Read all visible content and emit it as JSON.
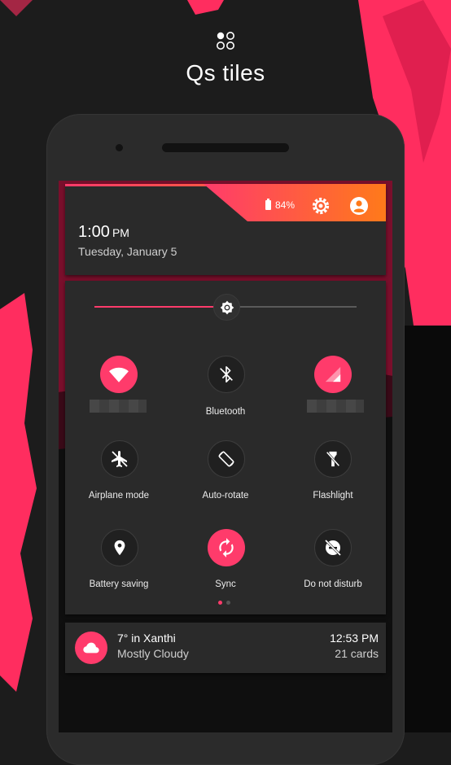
{
  "page": {
    "title": "Qs tiles",
    "title_icon": "four-dots-icon"
  },
  "colors": {
    "accent": "#ff3b6b",
    "gradient_start": "#ff3b6b",
    "gradient_end": "#ff7a1a",
    "panel": "#2a2a2a",
    "background": "#1c1c1c"
  },
  "status_header": {
    "battery_percent": "84%",
    "battery_icon": "battery-icon",
    "settings_icon": "gear-icon",
    "user_icon": "account-circle-icon",
    "time": "1:00",
    "ampm": "PM",
    "date": "Tuesday, January 5"
  },
  "brightness": {
    "level": 0.5,
    "icon": "brightness-icon"
  },
  "tiles": [
    {
      "label": "",
      "icon": "wifi-icon",
      "active": true
    },
    {
      "label": "Bluetooth",
      "icon": "bluetooth-off-icon",
      "active": false
    },
    {
      "label": "",
      "icon": "cellular-signal-icon",
      "active": true
    },
    {
      "label": "Airplane mode",
      "icon": "airplane-off-icon",
      "active": false
    },
    {
      "label": "Auto-rotate",
      "icon": "screen-rotation-icon",
      "active": false
    },
    {
      "label": "Flashlight",
      "icon": "flashlight-off-icon",
      "active": false
    },
    {
      "label": "Battery saving",
      "icon": "location-pin-icon",
      "active": false
    },
    {
      "label": "Sync",
      "icon": "sync-icon",
      "active": true
    },
    {
      "label": "Do not disturb",
      "icon": "do-not-disturb-icon",
      "active": false
    }
  ],
  "pager": {
    "current": 1,
    "total": 2
  },
  "notification": {
    "icon": "cloud-icon",
    "title": "7° in Xanthi",
    "subtitle": "Mostly Cloudy",
    "time": "12:53 PM",
    "count": "21 cards"
  }
}
